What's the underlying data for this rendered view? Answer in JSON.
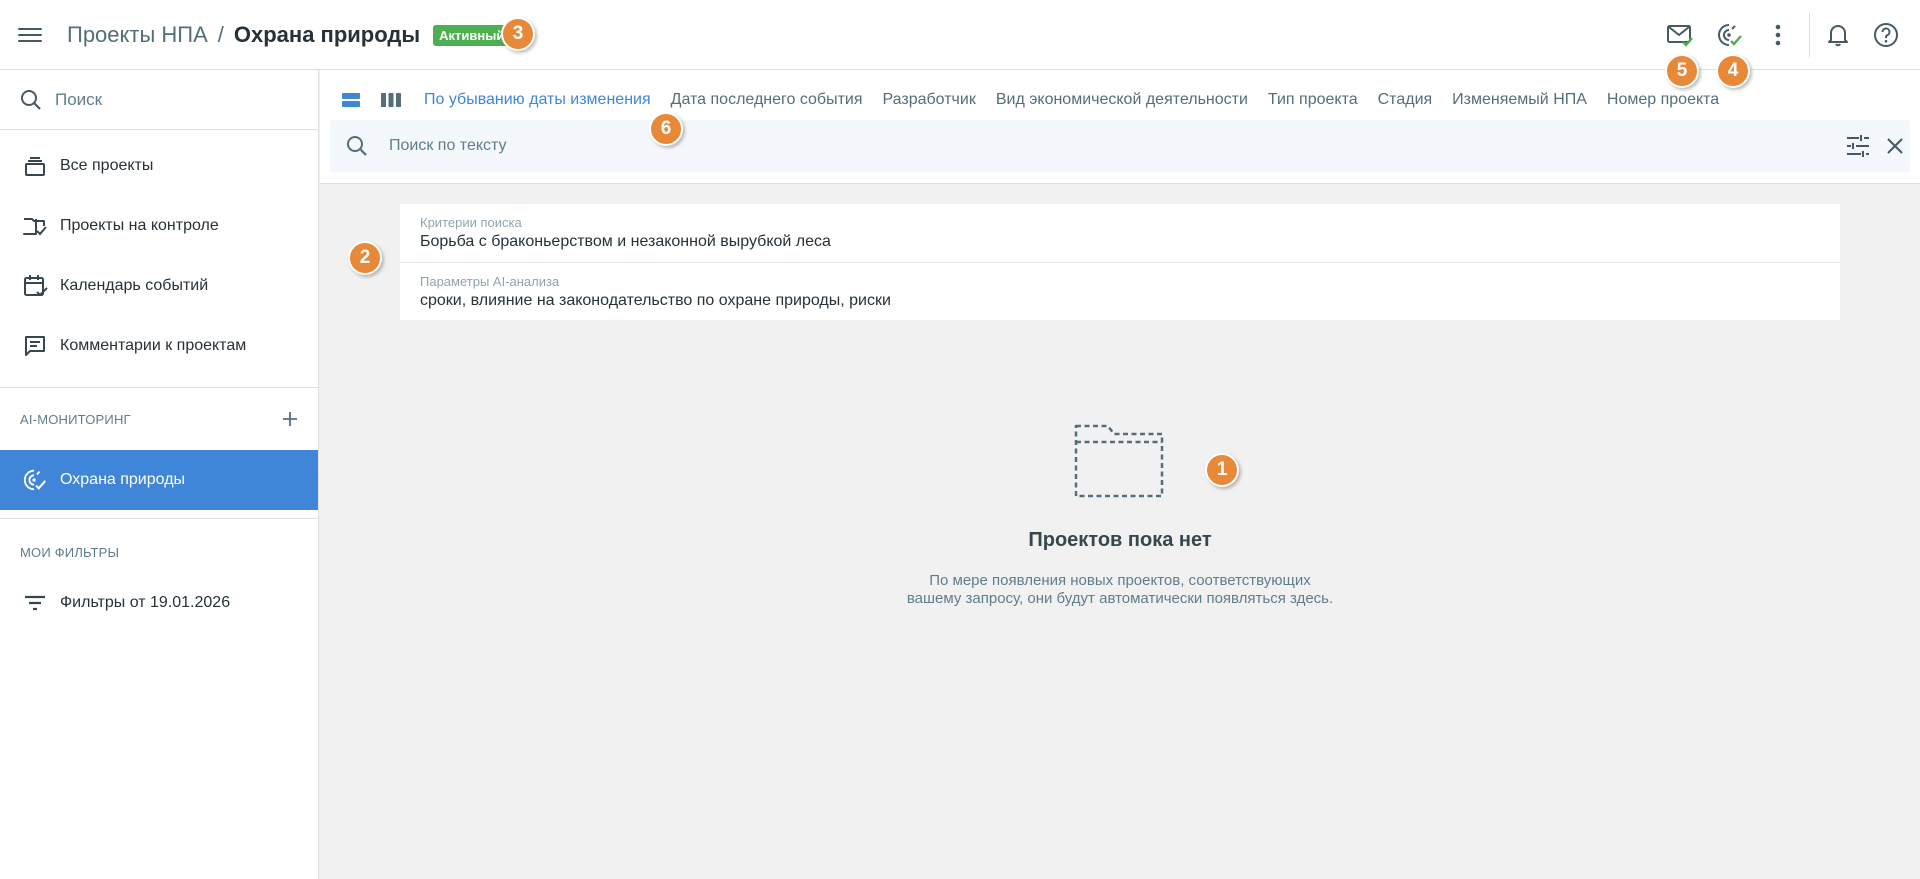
{
  "header": {
    "menu_icon": "hamburger-menu-icon",
    "breadcrumb_parent": "Проекты НПА",
    "breadcrumb_separator": "/",
    "breadcrumb_current": "Охрана природы",
    "status": "Активный",
    "status_color": "#4caf50",
    "icons": [
      "mail-check-icon",
      "ai-monitoring-check-icon",
      "more-vertical-icon",
      "bell-icon",
      "help-icon"
    ]
  },
  "sidebar": {
    "search_placeholder": "Поиск",
    "nav": [
      {
        "label": "Все проекты",
        "icon": "stack-icon"
      },
      {
        "label": "Проекты на контроле",
        "icon": "folder-check-icon"
      },
      {
        "label": "Календарь событий",
        "icon": "calendar-check-icon"
      },
      {
        "label": "Комментарии к проектам",
        "icon": "comment-icon"
      }
    ],
    "ai_section_title": "AI-МОНИТОРИНГ",
    "ai_items": [
      {
        "label": "Охрана природы",
        "icon": "ai-monitoring-icon",
        "active": true
      }
    ],
    "filters_section_title": "МОИ ФИЛЬТРЫ",
    "filters": [
      {
        "label": "Фильтры от 19.01.2026",
        "icon": "filter-icon"
      }
    ]
  },
  "toolbar": {
    "sort_options": [
      "По убыванию даты изменения",
      "Дата последнего события",
      "Разработчик",
      "Вид экономической деятельности",
      "Тип проекта",
      "Стадия",
      "Изменяемый НПА",
      "Номер проекта"
    ],
    "active_sort_index": 0,
    "search_placeholder": "Поиск по тексту"
  },
  "criteria": {
    "search_label": "Критерии поиска",
    "search_value": "Борьба с браконьерством и незаконной вырубкой леса",
    "ai_label": "Параметры AI-анализа",
    "ai_value": "сроки, влияние на законодательство по охране природы, риски"
  },
  "empty_state": {
    "title": "Проектов пока нет",
    "description_line1": "По мере появления новых проектов, соответствующих",
    "description_line2": "вашему запросу, они будут автоматически появляться здесь."
  },
  "markers": [
    "1",
    "2",
    "3",
    "4",
    "5",
    "6"
  ],
  "colors": {
    "accent": "#3f86d9",
    "marker": "#e8893a",
    "success": "#4caf50"
  }
}
